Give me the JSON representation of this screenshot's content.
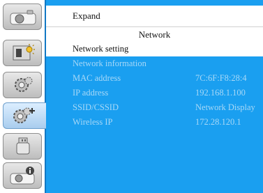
{
  "sidebar": {
    "tabs": [
      {
        "name": "image-tab",
        "icon": "camera-icon"
      },
      {
        "name": "display-tab",
        "icon": "screen-brightness-icon"
      },
      {
        "name": "setting-tab",
        "icon": "gear-icon"
      },
      {
        "name": "expand-tab",
        "icon": "gear-plus-icon",
        "active": true
      },
      {
        "name": "usb-tab",
        "icon": "usb-drive-icon"
      },
      {
        "name": "info-tab",
        "icon": "camera-info-icon"
      }
    ]
  },
  "breadcrumb": {
    "label": "Expand"
  },
  "header": {
    "title": "Network"
  },
  "menu": {
    "rows": [
      {
        "label": "Network setting",
        "value": "",
        "state": "selected"
      },
      {
        "label": "Network information",
        "value": "",
        "state": "disabled"
      },
      {
        "label": "MAC address",
        "value": "7C:6F:F8:28:4",
        "state": "disabled"
      },
      {
        "label": "IP address",
        "value": "192.168.1.100",
        "state": "disabled"
      },
      {
        "label": "SSID/CSSID",
        "value": "Network Display",
        "state": "disabled"
      },
      {
        "label": "Wireless IP",
        "value": "172.28.120.1",
        "state": "disabled"
      }
    ]
  },
  "colors": {
    "panel_blue": "#1a9ff0",
    "disabled_text": "#a7d8f7",
    "selected_bg": "#ffffff"
  }
}
